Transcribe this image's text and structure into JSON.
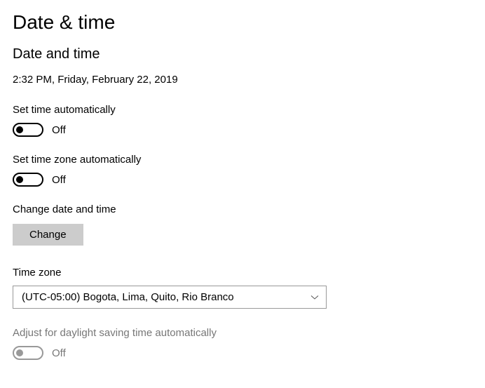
{
  "page_title": "Date & time",
  "section_title": "Date and time",
  "current_datetime": "2:32 PM, Friday, February 22, 2019",
  "set_time_auto": {
    "label": "Set time automatically",
    "state": "Off"
  },
  "set_timezone_auto": {
    "label": "Set time zone automatically",
    "state": "Off"
  },
  "change_datetime": {
    "label": "Change date and time",
    "button": "Change"
  },
  "timezone": {
    "label": "Time zone",
    "selected": "(UTC-05:00) Bogota, Lima, Quito, Rio Branco"
  },
  "dst": {
    "label": "Adjust for daylight saving time automatically",
    "state": "Off"
  }
}
